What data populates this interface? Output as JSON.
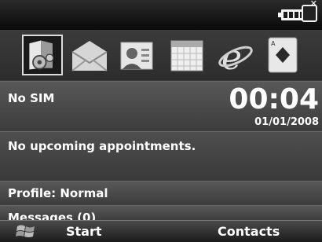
{
  "status": {
    "battery_icon": "battery-icon",
    "signal_icon": "no-signal-icon"
  },
  "icons": [
    {
      "name": "settings-folder-icon",
      "selected": true
    },
    {
      "name": "messaging-envelope-icon",
      "selected": false
    },
    {
      "name": "contacts-card-icon",
      "selected": false
    },
    {
      "name": "calendar-icon",
      "selected": false
    },
    {
      "name": "internet-explorer-icon",
      "selected": false
    },
    {
      "name": "solitaire-card-icon",
      "selected": false
    }
  ],
  "today": {
    "carrier": "No SIM",
    "time": "00:04",
    "date": "01/01/2008",
    "appointments": "No upcoming appointments.",
    "profile": "Profile: Normal",
    "messages": "Messages (0)"
  },
  "softkeys": {
    "left": "Start",
    "right": "Contacts"
  }
}
